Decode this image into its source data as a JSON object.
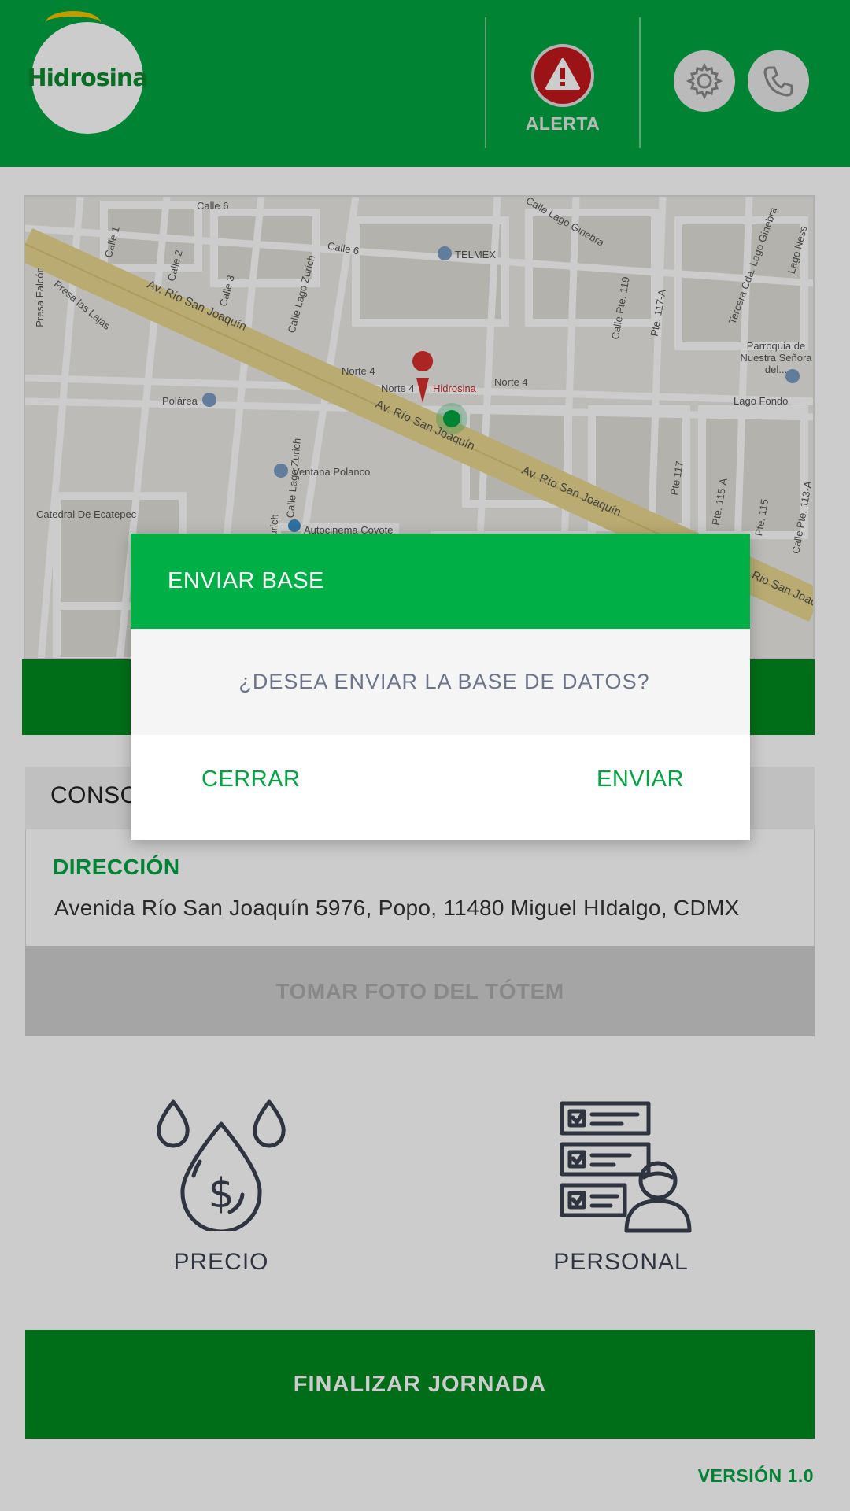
{
  "header": {
    "logo_text": "Hidrosina",
    "alert_label": "ALERTA",
    "icons": [
      "warning-icon",
      "gear-icon",
      "phone-icon"
    ]
  },
  "map": {
    "labels": [
      "Calle 6",
      "Calle 1",
      "Calle 2",
      "Calle 3",
      "Calle Lago Zurich",
      "Calle 6",
      "TELMEX",
      "Calle Lago Ginebra",
      "Av. Río San Joaquín",
      "Presa las Lajas",
      "Presa Falcón",
      "Norte 4",
      "Norte 4",
      "Hidrosina",
      "Norte 4",
      "Polárea",
      "Av. Río San Joaquín",
      "Ventana Polanco",
      "Av. Río San Joaquín",
      "Catedral De Ecatepec",
      "Autocinema Coyote",
      "Parroquia de Nuestra Señora del...",
      "Lago Fondo",
      "Rio San Joaq",
      "Calle Pte. 119",
      "Pte. 117-A",
      "Pte 117",
      "Pte. 115-A",
      "Pte. 115",
      "Calle Pte. 113-A",
      "Tercera Cda. Lago Ginebra",
      "Lago Ness",
      "Calle Lago Zurich",
      "Lago Zurich"
    ]
  },
  "consult": {
    "title": "CONSO",
    "address_label": "DIRECCIÓN",
    "address": "Avenida Río San Joaquín 5976, Popo, 11480 Miguel HIdalgo, CDMX",
    "photo_button": "TOMAR FOTO DEL TÓTEM"
  },
  "tiles": {
    "price_label": "PRECIO",
    "staff_label": "PERSONAL"
  },
  "finish_button": "FINALIZAR JORNADA",
  "version": "VERSIÓN 1.0",
  "dialog": {
    "title": "ENVIAR BASE",
    "message": "¿DESEA ENVIAR LA BASE DE DATOS?",
    "close_label": "CERRAR",
    "send_label": "ENVIAR"
  },
  "colors": {
    "primary_green": "#00a541",
    "dark_green": "#008a1e",
    "dialog_header": "#00b047",
    "alert_red": "#c2181c"
  }
}
